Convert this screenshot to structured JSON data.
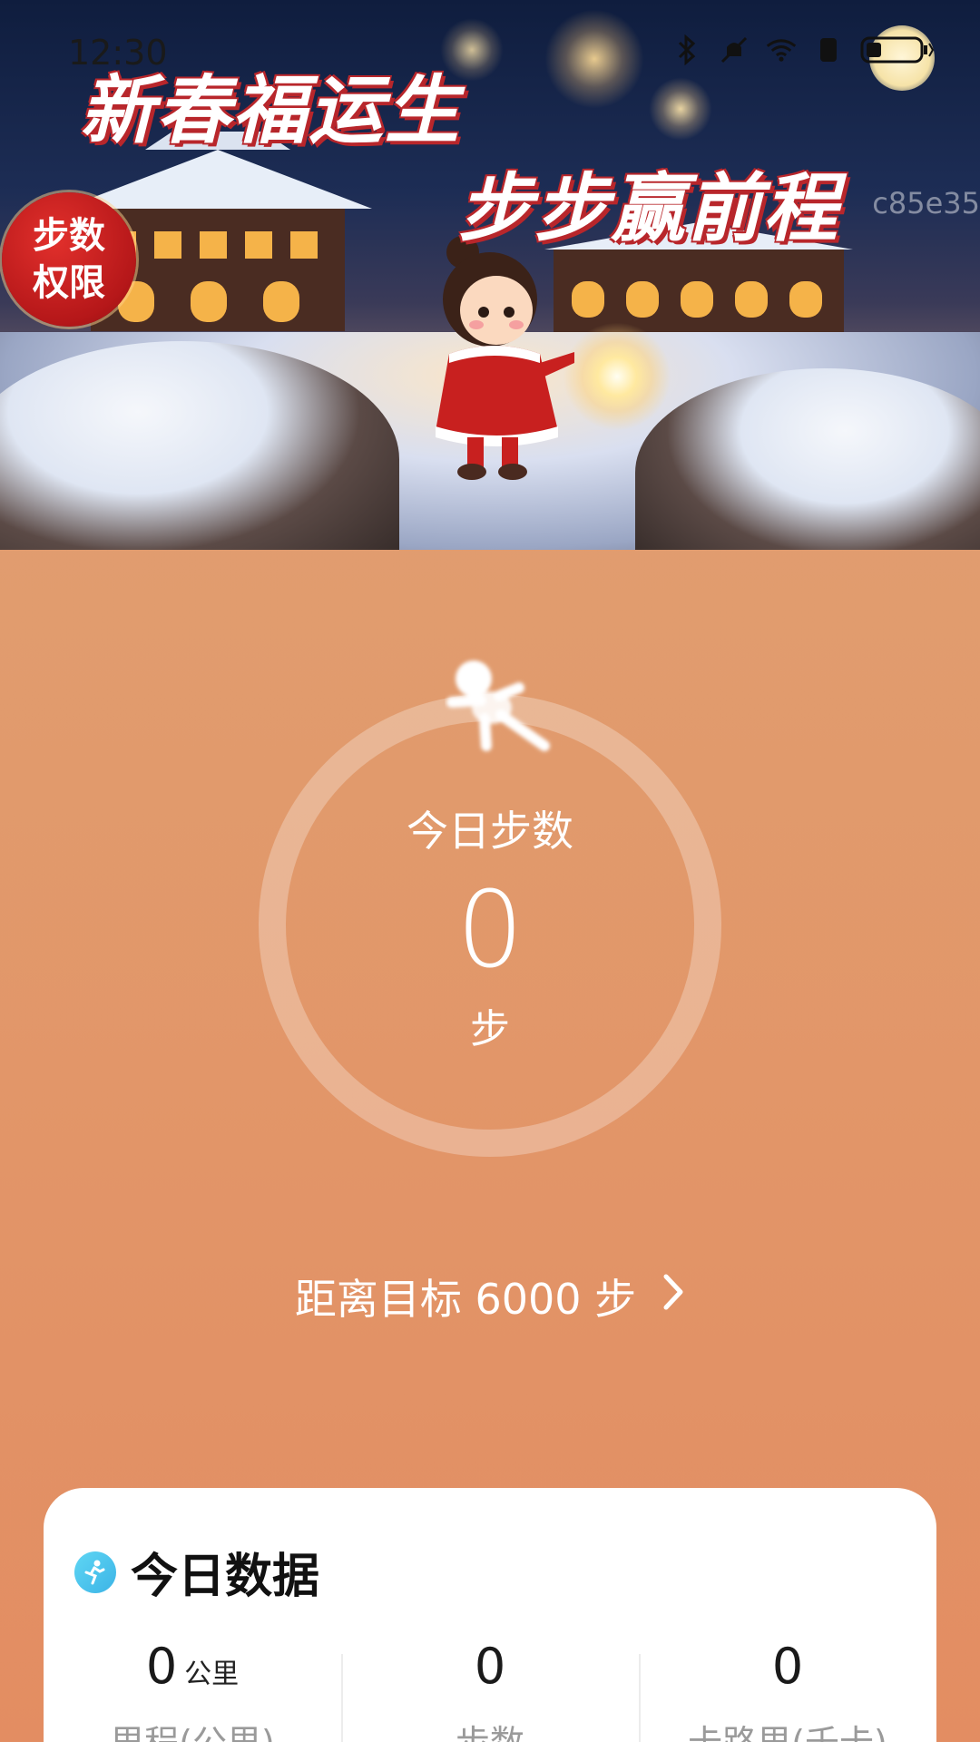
{
  "status_bar": {
    "time": "12:30",
    "icons": [
      "bluetooth-icon",
      "mute-icon",
      "wifi-icon",
      "sim-icon",
      "battery-icon"
    ]
  },
  "banner": {
    "title_line1": "新春福运生",
    "title_line2": "步步赢前程",
    "badge_text": "步数权限",
    "watermark": "c85e35"
  },
  "steps_ring": {
    "title": "今日步数",
    "count": "0",
    "unit": "步",
    "progress": 0
  },
  "goal": {
    "text": "距离目标 6000 步"
  },
  "today_card": {
    "title": "今日数据",
    "stats": [
      {
        "value": "0",
        "unit": "公里",
        "label": "里程(公里)"
      },
      {
        "value": "0",
        "unit": "",
        "label": "步数"
      },
      {
        "value": "0",
        "unit": "",
        "label": "卡路里(千卡)"
      }
    ]
  },
  "colors": {
    "background_top": "#e0a276",
    "background_bottom": "#e38d62",
    "banner_title_outline": "#b8262b",
    "badge_red": "#c21d1f",
    "card_icon": "#3cb4e6"
  }
}
